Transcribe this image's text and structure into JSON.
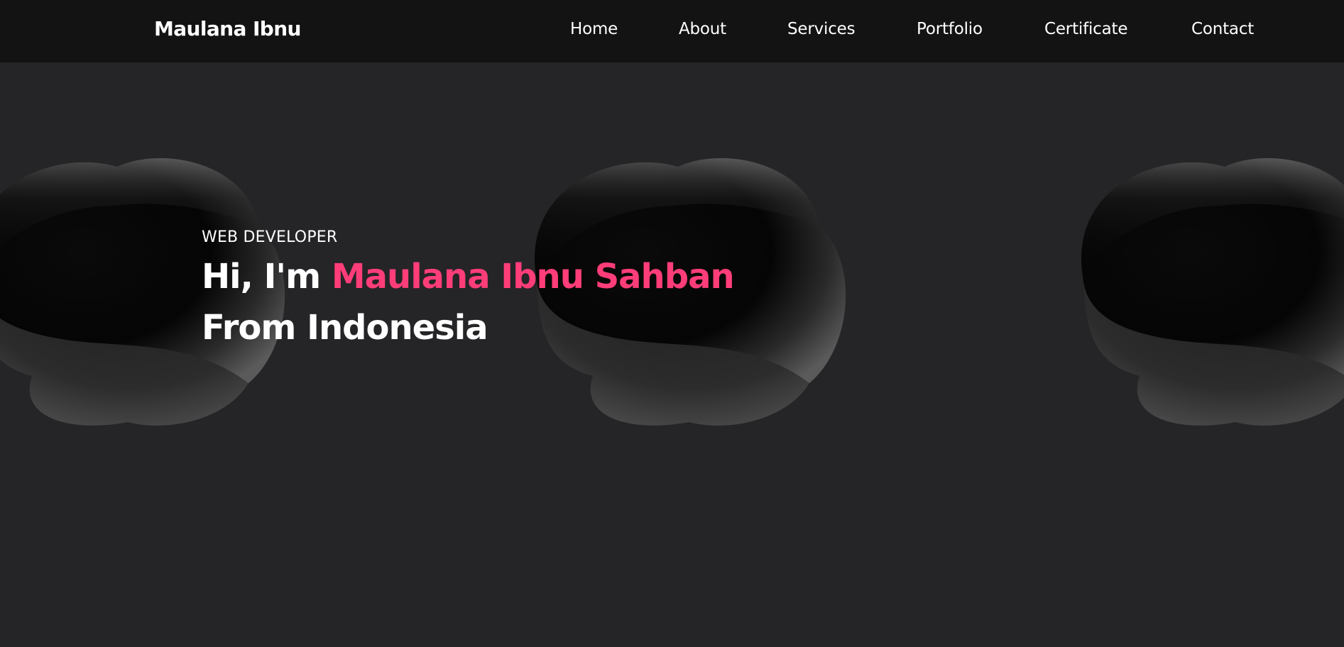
{
  "brand": {
    "name": "Maulana Ibnu"
  },
  "nav": {
    "items": [
      {
        "label": "Home"
      },
      {
        "label": "About"
      },
      {
        "label": "Services"
      },
      {
        "label": "Portfolio"
      },
      {
        "label": "Certificate"
      },
      {
        "label": "Contact"
      }
    ]
  },
  "hero": {
    "eyebrow": "WEB DEVELOPER",
    "greeting": "Hi, I'm",
    "name": "Maulana Ibnu Sahban",
    "origin": "From Indonesia"
  },
  "colors": {
    "background": "#252427",
    "navbar": "#131313",
    "text": "#ffffff",
    "accent": "#ff3d79"
  }
}
